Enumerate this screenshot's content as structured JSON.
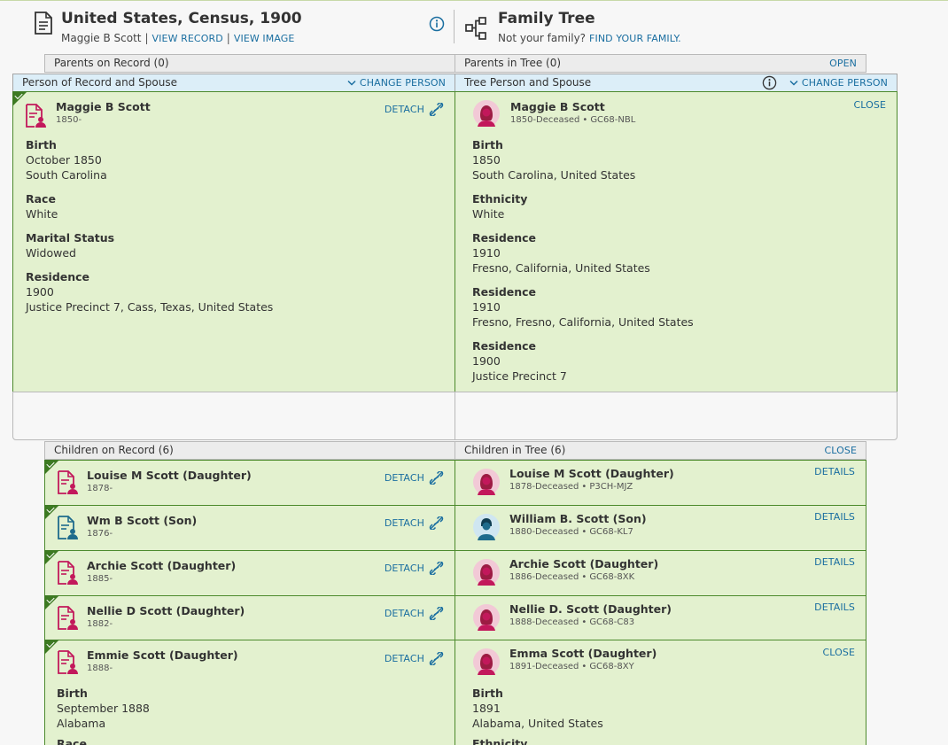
{
  "header": {
    "record_title": "United States, Census, 1900",
    "record_person": "Maggie B Scott",
    "sep": "|",
    "view_record": "VIEW RECORD",
    "view_image": "VIEW IMAGE",
    "tree_title": "Family Tree",
    "not_family": "Not your family?",
    "find_family": "FIND YOUR FAMILY."
  },
  "parents": {
    "record_label": "Parents on Record (0)",
    "tree_label": "Parents in Tree (0)",
    "open": "OPEN"
  },
  "spouse": {
    "record_label": "Person of Record and Spouse",
    "tree_label": "Tree Person and Spouse",
    "change_person": "CHANGE PERSON"
  },
  "labels": {
    "detach": "DETACH",
    "close": "CLOSE",
    "details": "DETAILS"
  },
  "record_person": {
    "name": "Maggie B Scott",
    "dates": "1850-",
    "facts": [
      {
        "label": "Birth",
        "lines": [
          "October 1850",
          "South Carolina"
        ]
      },
      {
        "label": "Race",
        "lines": [
          "White"
        ]
      },
      {
        "label": "Marital Status",
        "lines": [
          "Widowed"
        ]
      },
      {
        "label": "Residence",
        "lines": [
          "1900",
          "Justice Precinct 7, Cass, Texas, United States"
        ]
      }
    ]
  },
  "tree_person": {
    "name": "Maggie B Scott",
    "dates": "1850-Deceased",
    "id": "GC68-NBL",
    "facts": [
      {
        "label": "Birth",
        "lines": [
          "1850",
          "South Carolina, United States"
        ]
      },
      {
        "label": "Ethnicity",
        "lines": [
          "White"
        ]
      },
      {
        "label": "Residence",
        "lines": [
          "1910",
          "Fresno, California, United States"
        ]
      },
      {
        "label": "Residence",
        "lines": [
          "1910",
          "Fresno, Fresno, California, United States"
        ]
      },
      {
        "label": "Residence",
        "lines": [
          "1900",
          "Justice Precinct 7"
        ]
      }
    ]
  },
  "children": {
    "record_label": "Children on Record (6)",
    "tree_label": "Children in Tree (6)",
    "close": "CLOSE",
    "rows": [
      {
        "rec_name": "Louise M Scott (Daughter)",
        "rec_dates": "1878-",
        "rec_color": "#c2185b",
        "tree_name": "Louise M Scott (Daughter)",
        "tree_dates": "1878-Deceased",
        "tree_id": "P3CH-MJZ",
        "tree_gender": "female",
        "action": "DETAILS"
      },
      {
        "rec_name": "Wm B Scott (Son)",
        "rec_dates": "1876-",
        "rec_color": "#1e6b8c",
        "tree_name": "William B. Scott (Son)",
        "tree_dates": "1880-Deceased",
        "tree_id": "GC68-KL7",
        "tree_gender": "male",
        "action": "DETAILS"
      },
      {
        "rec_name": "Archie Scott (Daughter)",
        "rec_dates": "1885-",
        "rec_color": "#c2185b",
        "tree_name": "Archie Scott (Daughter)",
        "tree_dates": "1886-Deceased",
        "tree_id": "GC68-8XK",
        "tree_gender": "female",
        "action": "DETAILS"
      },
      {
        "rec_name": "Nellie D Scott (Daughter)",
        "rec_dates": "1882-",
        "rec_color": "#c2185b",
        "tree_name": "Nellie D. Scott (Daughter)",
        "tree_dates": "1888-Deceased",
        "tree_id": "GC68-C83",
        "tree_gender": "female",
        "action": "DETAILS"
      }
    ],
    "expanded": {
      "rec_name": "Emmie Scott (Daughter)",
      "rec_dates": "1888-",
      "rec_facts": [
        {
          "label": "Birth",
          "lines": [
            "September 1888",
            "Alabama"
          ]
        },
        {
          "label": "Race",
          "lines": []
        }
      ],
      "tree_name": "Emma Scott (Daughter)",
      "tree_dates": "1891-Deceased",
      "tree_id": "GC68-8XY",
      "tree_facts": [
        {
          "label": "Birth",
          "lines": [
            "1891",
            "Alabama, United States"
          ]
        },
        {
          "label": "Ethnicity",
          "lines": []
        }
      ],
      "action": "CLOSE"
    }
  },
  "colors": {
    "green_panel": "#e3f1cf",
    "green_border": "#4c8a2c",
    "link": "#1a6ea0",
    "female": "#c2185b",
    "male": "#1e6b8c"
  }
}
